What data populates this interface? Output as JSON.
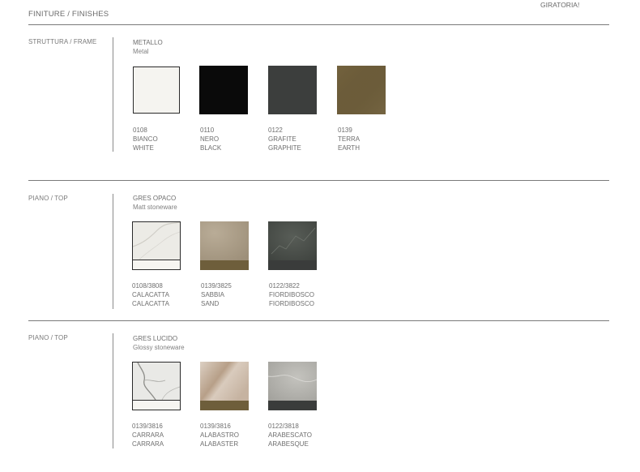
{
  "header": {
    "title": "FINITURE / FINISHES",
    "corner_note": "GIRATORIA!"
  },
  "frame": {
    "label": "STRUTTURA / FRAME",
    "group_title": "METALLO",
    "group_subtitle": "Metal",
    "items": [
      {
        "code": "0108",
        "name_it": "BIANCO",
        "name_en": "WHITE",
        "color": "#f5f4f0"
      },
      {
        "code": "0110",
        "name_it": "NERO",
        "name_en": "BLACK",
        "color": "#0a0a0a"
      },
      {
        "code": "0122",
        "name_it": "GRAFITE",
        "name_en": "GRAPHITE",
        "color": "#3c3e3d"
      },
      {
        "code": "0139",
        "name_it": "TERRA",
        "name_en": "EARTH",
        "color": "#6e5e3b"
      }
    ]
  },
  "top_matt": {
    "label": "PIANO / TOP",
    "group_title": "GRES OPACO",
    "group_subtitle": "Matt stoneware",
    "items": [
      {
        "code": "0108/3808",
        "name_it": "CALACATTA",
        "name_en": "CALACATTA",
        "color": "#e9e7e1",
        "band_color": "#f6f5f1"
      },
      {
        "code": "0139/3825",
        "name_it": "SABBIA",
        "name_en": "SAND",
        "color": "#aa9c86",
        "band_color": "#6e5e3b"
      },
      {
        "code": "0122/3822",
        "name_it": "FIORDIBOSCO",
        "name_en": "FIORDIBOSCO",
        "color": "#4a4e4a",
        "band_color": "#3a3c3b"
      }
    ]
  },
  "top_glossy": {
    "label": "PIANO / TOP",
    "group_title": "GRES LUCIDO",
    "group_subtitle": "Glossy stoneware",
    "items": [
      {
        "code": "0139/3816",
        "name_it": "CARRARA",
        "name_en": "CARRARA",
        "color": "#e6e6e3",
        "band_color": "#f6f5f1"
      },
      {
        "code": "0139/3816",
        "name_it": "ALABASTRO",
        "name_en": "ALABASTER",
        "color": "#c9b7a6",
        "band_color": "#6e5e3b"
      },
      {
        "code": "0122/3818",
        "name_it": "ARABESCATO",
        "name_en": "ARABESQUE",
        "color": "#b3b2ad",
        "band_color": "#3a3c3b"
      }
    ]
  }
}
